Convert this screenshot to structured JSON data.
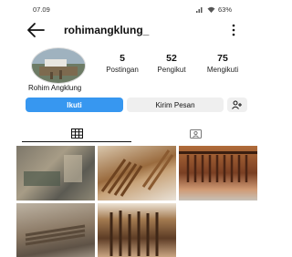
{
  "status_bar": {
    "time": "07.09",
    "battery": "63%"
  },
  "header": {
    "username": "rohimangklung_"
  },
  "profile": {
    "stats": [
      {
        "value": "5",
        "label": "Postingan"
      },
      {
        "value": "52",
        "label": "Pengikut"
      },
      {
        "value": "75",
        "label": "Mengikuti"
      }
    ],
    "display_name": "Rohim Angklung"
  },
  "actions": {
    "follow_label": "Ikuti",
    "message_label": "Kirim Pesan"
  },
  "icons": {
    "back": "arrow-left-icon",
    "more": "more-vertical-icon",
    "add_user": "add-user-icon",
    "grid": "grid-icon",
    "tagged": "tagged-photos-icon"
  },
  "colors": {
    "follow_button": "#3797f0",
    "secondary_button": "#efefef"
  }
}
